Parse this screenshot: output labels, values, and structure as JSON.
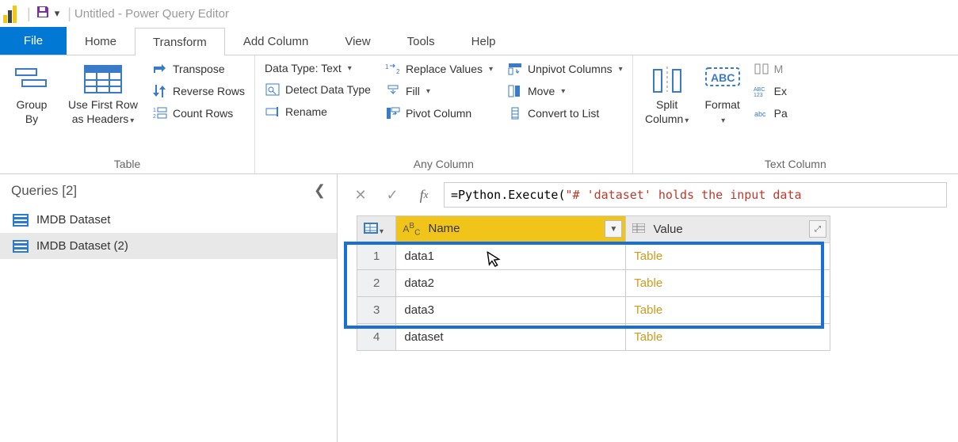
{
  "titlebar": {
    "title": "Untitled - Power Query Editor"
  },
  "tabs": {
    "file": "File",
    "items": [
      "Home",
      "Transform",
      "Add Column",
      "View",
      "Tools",
      "Help"
    ],
    "active_index": 1
  },
  "ribbon": {
    "groups": {
      "table": {
        "label": "Table",
        "group_by": "Group\nBy",
        "use_first": "Use First Row\nas Headers",
        "transpose": "Transpose",
        "reverse": "Reverse Rows",
        "count": "Count Rows"
      },
      "any_column": {
        "label": "Any Column",
        "data_type": "Data Type: Text",
        "detect": "Detect Data Type",
        "rename": "Rename",
        "replace": "Replace Values",
        "fill": "Fill",
        "pivot": "Pivot Column",
        "unpivot": "Unpivot Columns",
        "move": "Move",
        "convert": "Convert to List"
      },
      "text_column": {
        "label": "Text Column",
        "split": "Split\nColumn",
        "format": "Format",
        "merge_short": "M",
        "extract_short": "Ex",
        "parse_short": "Pa"
      }
    }
  },
  "queries": {
    "header": "Queries [2]",
    "items": [
      {
        "label": "IMDB Dataset"
      },
      {
        "label": "IMDB Dataset (2)"
      }
    ],
    "selected_index": 1
  },
  "formula": {
    "prefix": "= ",
    "call": "Python.Execute(",
    "string": "\"# 'dataset' holds the input data "
  },
  "table": {
    "columns": [
      {
        "key": "name",
        "label": "Name",
        "type_icon": "ABC"
      },
      {
        "key": "value",
        "label": "Value",
        "type_icon": "table"
      }
    ],
    "rows": [
      {
        "n": "1",
        "name": "data1",
        "value": "Table"
      },
      {
        "n": "2",
        "name": "data2",
        "value": "Table"
      },
      {
        "n": "3",
        "name": "data3",
        "value": "Table"
      },
      {
        "n": "4",
        "name": "dataset",
        "value": "Table"
      }
    ]
  }
}
